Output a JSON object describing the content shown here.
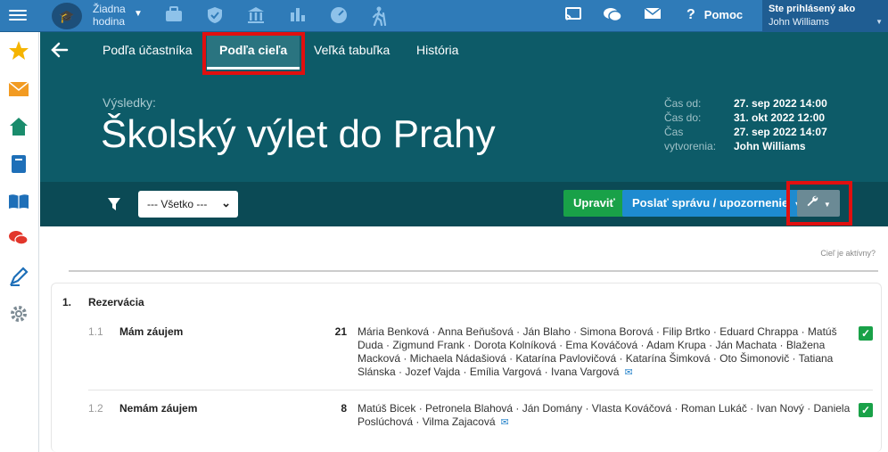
{
  "topbar": {
    "lesson": "Žiadna hodina",
    "help_label": "Pomoc",
    "logged_label": "Ste prihlásený ako",
    "user_name": "John Williams"
  },
  "tabs": [
    {
      "label": "Podľa účastníka"
    },
    {
      "label": "Podľa cieľa"
    },
    {
      "label": "Veľká tabuľka"
    },
    {
      "label": "História"
    }
  ],
  "header": {
    "results_label": "Výsledky:",
    "title": "Školský výlet do Prahy",
    "meta": [
      {
        "k": "Čas od:",
        "v": "27. sep 2022 14:00"
      },
      {
        "k": "Čas do:",
        "v": "31. okt 2022 12:00"
      },
      {
        "k": "Čas vytvorenia:",
        "v": "27. sep 2022 14:07"
      },
      {
        "k": "",
        "v": "John Williams"
      }
    ]
  },
  "filterbar": {
    "select_value": "--- Všetko ---",
    "edit_label": "Upraviť",
    "send_label": "Poslať správu / upozornenie"
  },
  "content": {
    "active_question": "Cieľ je aktívny?",
    "section_number": "1.",
    "section_title": "Rezervácia",
    "options": [
      {
        "num": "1.1",
        "label": "Mám záujem",
        "count": "21",
        "names": "Mária Benková · Anna Beňušová · Ján Blaho · Simona Borová · Filip Brtko · Eduard Chrappa · Matúš Duda · Zigmund Frank · Dorota Kolníková · Ema Kováčová · Adam Krupa · Ján Machata · Blažena Macková · Michaela Nádašiová · Katarína Pavlovičová · Katarína Šimková · Oto Šimonovič · Tatiana Slánska · Jozef Vajda · Emília Vargová · Ivana Vargová"
      },
      {
        "num": "1.2",
        "label": "Nemám záujem",
        "count": "8",
        "names": "Matúš Bicek · Petronela Blahová · Ján Domány · Vlasta Kováčová · Roman Lukáč · Ivan Nový · Daniela Poslúchová · Vilma Zajacová"
      }
    ]
  },
  "colors": {
    "topbar": "#2f7bb8",
    "header": "#0d5b68",
    "filterbar": "#0b4a55",
    "highlight": "#e10f0f",
    "green": "#19a148",
    "blue": "#1e8bd0"
  },
  "icons": {
    "topbar": [
      "menu-icon",
      "graduation-cap-icon",
      "briefcase-icon",
      "shield-icon",
      "bank-icon",
      "bar-chart-icon",
      "gauge-icon",
      "hiking-icon",
      "cast-icon",
      "chat-icon",
      "mail-icon",
      "help-icon"
    ],
    "sidebar": [
      "star-icon",
      "envelope-icon",
      "home-icon",
      "notebook-icon",
      "book-open-icon",
      "discussion-icon",
      "pen-icon",
      "gear-icon"
    ]
  }
}
